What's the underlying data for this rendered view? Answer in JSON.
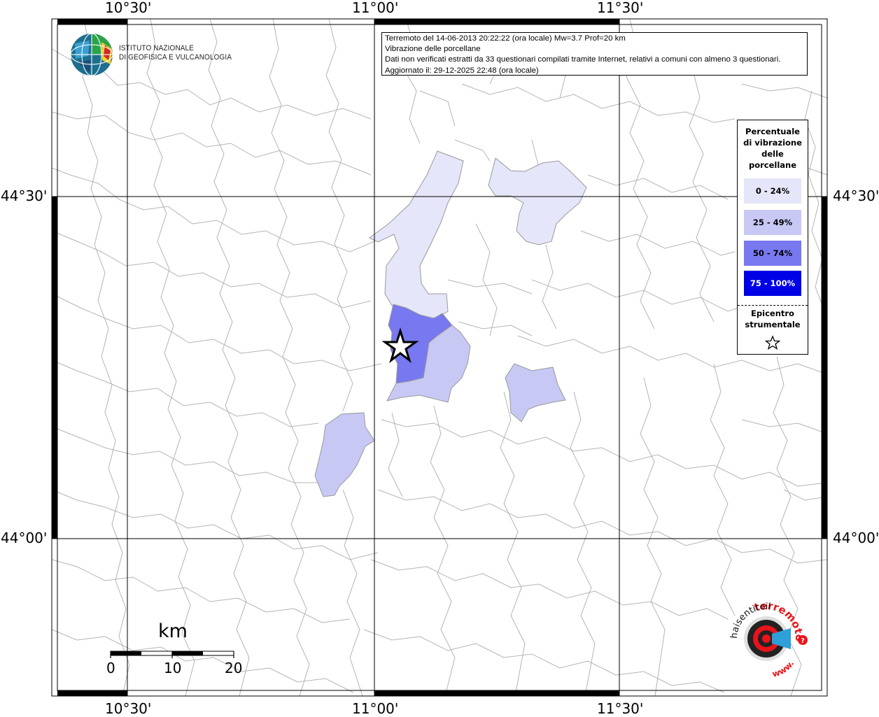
{
  "info": {
    "line1": "Terremoto del 14-06-2013 20:22:22 (ora locale) Mw=3.7 Prof=20 km",
    "line2": "Vibrazione delle porcellane",
    "line3": "Dati non verificati estratti da 33 questionari compilati tramite Internet, relativi a comuni con almeno 3 questionari.",
    "line4": "Aggiornato il: 29-12-2025 22:48 (ora locale)"
  },
  "logo": {
    "line1": "ISTITUTO NAZIONALE",
    "line2": "DI GEOFISICA E VULCANOLOGIA"
  },
  "legend": {
    "title_line1": "Percentuale",
    "title_line2": "di vibrazione",
    "title_line3": "delle",
    "title_line4": "porcellane",
    "items": [
      {
        "label": "0 - 24%",
        "color": "#e6e6fa"
      },
      {
        "label": "25 - 49%",
        "color": "#c8c8f5"
      },
      {
        "label": "50 - 74%",
        "color": "#7878f0"
      },
      {
        "label": "75 - 100%",
        "color": "#0000e6"
      }
    ],
    "epicenter_line1": "Epicentro",
    "epicenter_line2": "strumentale"
  },
  "coords": {
    "lon_1": "10°30'",
    "lon_2": "11°00'",
    "lon_3": "11°30'",
    "lat_1": "44°30'",
    "lat_2": "44°00'"
  },
  "scale": {
    "unit": "km",
    "tick_0": "0",
    "tick_10": "10",
    "tick_20": "20"
  },
  "badge": {
    "text_top": "terremoto.it",
    "text_left": "haisentitoil",
    "text_bottom": "www."
  },
  "colors": {
    "class_0_24": "#e6e6fa",
    "class_25_49": "#c8c8f5",
    "class_50_74": "#7878f0",
    "class_75_100": "#0000e6",
    "boundary": "#aaaaaa",
    "grid": "#000000",
    "badge_red": "#e8141c",
    "badge_blue": "#2f9fd8"
  }
}
